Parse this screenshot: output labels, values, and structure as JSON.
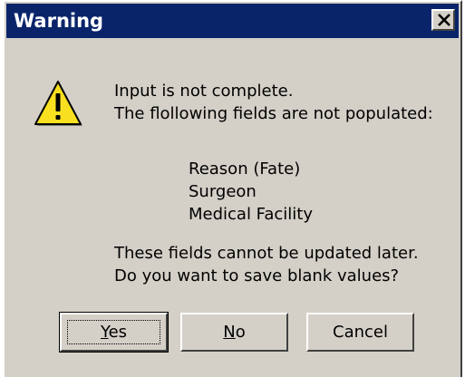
{
  "window": {
    "title": "Warning",
    "close_icon": "close-icon"
  },
  "icon": {
    "name": "warning-icon",
    "glyph": "!",
    "color": "#f8e020"
  },
  "message": {
    "intro": [
      "Input is not complete.",
      "The flollowing fields are not populated:"
    ],
    "fields": [
      "Reason (Fate)",
      "Surgeon",
      "Medical Facility"
    ],
    "question": [
      "These fields cannot be updated later.",
      "Do you want to save blank values?"
    ]
  },
  "buttons": {
    "yes": {
      "accel": "Y",
      "rest": "es"
    },
    "no": {
      "accel": "N",
      "rest": "o"
    },
    "cancel": {
      "label": "Cancel"
    }
  },
  "colors": {
    "titlebar": "#0a246a",
    "dialog_bg": "#d4d0c8",
    "title_text": "#ffffff"
  }
}
